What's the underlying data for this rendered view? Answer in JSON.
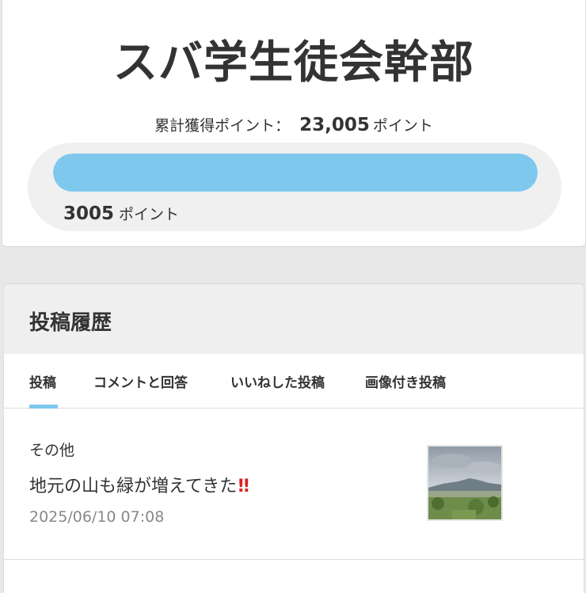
{
  "profile": {
    "rank_title": "スバ学生徒会幹部",
    "total_points_label": "累計獲得ポイント：",
    "total_points_value": "23,005",
    "points_unit": "ポイント",
    "progress_value": "3005",
    "progress_unit": "ポイント",
    "progress_fraction": 1.0
  },
  "history": {
    "title": "投稿履歴",
    "tabs": [
      {
        "label": "投稿",
        "active": true
      },
      {
        "label": "コメントと回答",
        "active": false
      },
      {
        "label": "いいねした投稿",
        "active": false
      },
      {
        "label": "画像付き投稿",
        "active": false
      }
    ],
    "posts": [
      {
        "category": "その他",
        "title": "地元の山も緑が増えてきた",
        "title_mark": "!!",
        "date": "2025/06/10 07:08",
        "thumbnail": "landscape-photo"
      }
    ]
  },
  "colors": {
    "accent": "#7ec8ee",
    "alert": "#d92020",
    "muted_text": "#888888"
  }
}
